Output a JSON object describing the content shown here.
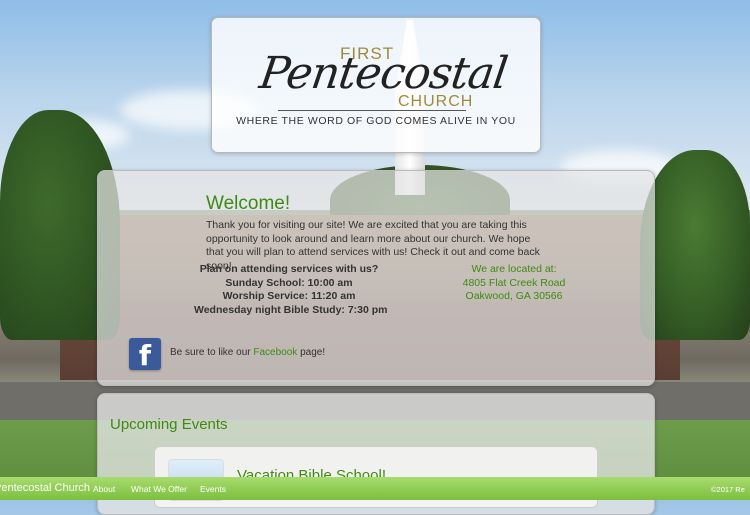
{
  "logo": {
    "first": "FIRST",
    "main": "Pentecostal",
    "church": "CHURCH",
    "tagline": "WHERE THE WORD OF GOD COMES ALIVE IN YOU"
  },
  "welcome": {
    "heading": "Welcome!",
    "intro": "Thank you for visiting our site! We are excited that you are taking this opportunity to look around and learn more about our church. We hope that you will plan to attend services with us! Check it out and come back soon!"
  },
  "services": {
    "heading": "Plan on attending services with us?",
    "lines": [
      "Sunday School: 10:00 am",
      "Worship Service: 11:20 am",
      "Wednesday night Bible Study: 7:30 pm"
    ]
  },
  "location": {
    "heading": "We are located at:",
    "street": "4805 Flat Creek Road",
    "city": "Oakwood, GA 30566"
  },
  "facebook": {
    "icon": "facebook-icon",
    "prefix": "Be sure to like our ",
    "link": "Facebook",
    "suffix": " page!"
  },
  "events": {
    "heading": "Upcoming Events",
    "items": [
      {
        "title": "Vacation Bible School!"
      }
    ]
  },
  "footer": {
    "name": "Pentecostal Church",
    "nav": [
      "About",
      "What We Offer",
      "Events"
    ],
    "copyright": "©2017 Re"
  },
  "colors": {
    "accent_green": "#3f8a12",
    "gold": "#a08a3a",
    "footer_green": "#8fcc52"
  }
}
